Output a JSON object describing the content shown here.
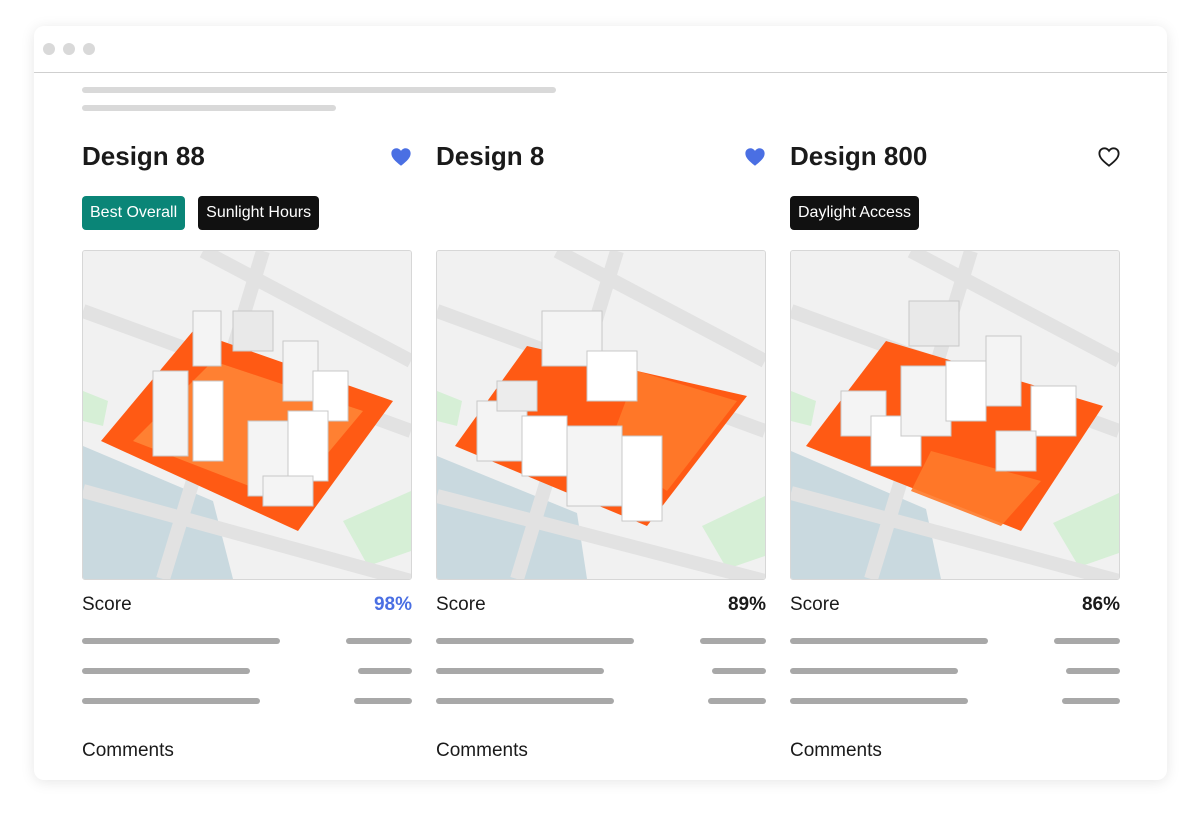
{
  "colors": {
    "accent_blue": "#4a6fe3",
    "tag_green": "#0a8577",
    "tag_black": "#111111",
    "heat_orange": "#ff5a14"
  },
  "designs": [
    {
      "title": "Design 88",
      "favorite": true,
      "heart_icon": "heart-filled-icon",
      "tags": [
        {
          "label": "Best Overall",
          "color": "#0a8577"
        },
        {
          "label": "Sunlight Hours",
          "color": "#111111"
        }
      ],
      "score_label": "Score",
      "score_value": "98%",
      "score_color": "#4a6fe3",
      "comments_label": "Comments"
    },
    {
      "title": "Design 8",
      "favorite": true,
      "heart_icon": "heart-filled-icon",
      "tags": [],
      "score_label": "Score",
      "score_value": "89%",
      "score_color": "#1a1a1a",
      "comments_label": "Comments"
    },
    {
      "title": "Design 800",
      "favorite": false,
      "heart_icon": "heart-outline-icon",
      "tags": [
        {
          "label": "Daylight Access",
          "color": "#111111"
        }
      ],
      "score_label": "Score",
      "score_value": "86%",
      "score_color": "#1a1a1a",
      "comments_label": "Comments"
    }
  ]
}
